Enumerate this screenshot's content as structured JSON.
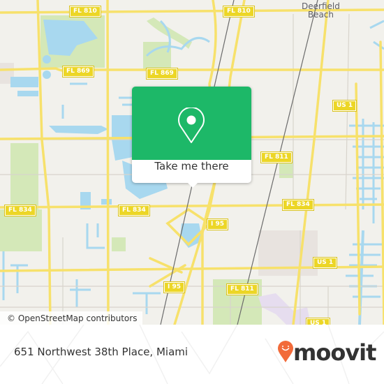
{
  "map": {
    "road_shields": [
      {
        "label": "FL 810"
      },
      {
        "label": "FL 810"
      },
      {
        "label": "FL 869"
      },
      {
        "label": "FL 869"
      },
      {
        "label": "FL 811"
      },
      {
        "label": "US 1"
      },
      {
        "label": "FL 834"
      },
      {
        "label": "FL 834"
      },
      {
        "label": "FL 834"
      },
      {
        "label": "I 95"
      },
      {
        "label": "US 1"
      },
      {
        "label": "I 95"
      },
      {
        "label": "FL 811"
      },
      {
        "label": "US 1"
      }
    ],
    "place_label": {
      "line1": "Deerfield",
      "line2": "Beach"
    },
    "attribution": "© OpenStreetMap contributors",
    "colors": {
      "land": "#f2f1ec",
      "water": "#a8d8ef",
      "park": "#d4e8b8",
      "road": "#f7e16b",
      "airport": "#e6ddef",
      "industrial": "#e8e3df"
    }
  },
  "popup": {
    "icon": "map-pin-icon",
    "button_label": "Take me there",
    "color": "#1db868"
  },
  "footer": {
    "address": "651 Northwest 38th Place, Miami",
    "brand": "moovit",
    "brand_color": "#f26b3a"
  }
}
